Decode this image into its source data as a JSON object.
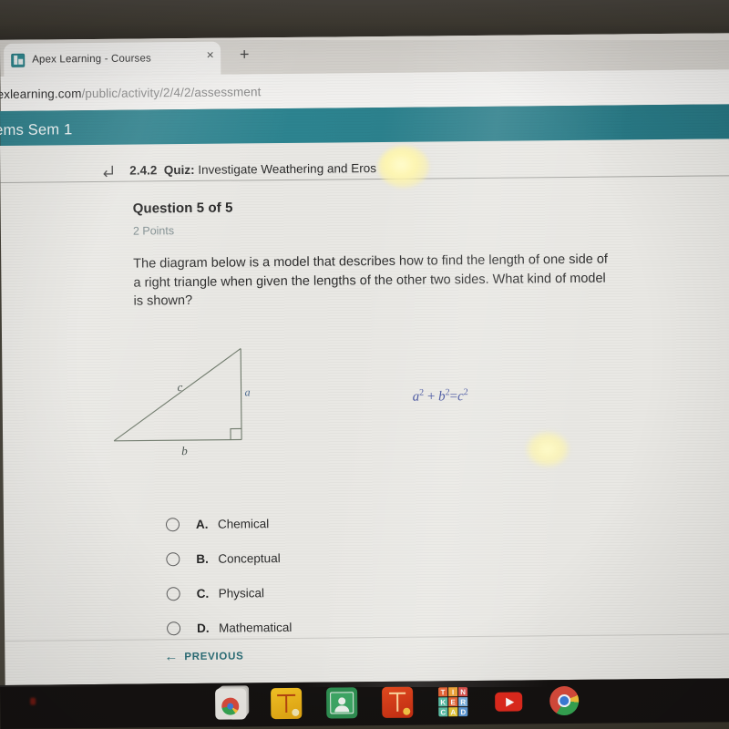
{
  "browser": {
    "tab": {
      "title": "Apex Learning - Courses",
      "favicon": "apex-favicon",
      "close_icon": "×"
    },
    "new_tab_icon": "+",
    "url_visible": "exlearning.com",
    "url_path": "/public/activity/2/4/2/assessment"
  },
  "app_header": {
    "course_title": "ems Sem 1"
  },
  "quiz_bar": {
    "back_icon": "back-arrow-icon",
    "number": "2.4.2",
    "type": "Quiz:",
    "name": "Investigate Weathering and Eros"
  },
  "question": {
    "counter": "Question 5 of 5",
    "points": "2 Points",
    "text": "The diagram below is a model that describes how to find the length of one side of a right triangle when given the lengths of the other two sides. What kind of model is shown?"
  },
  "diagram": {
    "label_hypotenuse": "c",
    "label_vertical": "a",
    "label_base": "b",
    "formula": {
      "a": "a",
      "a_exp": "2",
      "plus": "+",
      "b": "b",
      "b_exp": "2",
      "equals": "=",
      "c": "c",
      "c_exp": "2"
    },
    "right_angle_marker": "right-angle-icon",
    "stroke_color": "#6f7a6b",
    "formula_color": "#3d4c9b"
  },
  "choices": [
    {
      "letter": "A.",
      "label": "Chemical",
      "selected": false
    },
    {
      "letter": "B.",
      "label": "Conceptual",
      "selected": false
    },
    {
      "letter": "C.",
      "label": "Physical",
      "selected": false
    },
    {
      "letter": "D.",
      "label": "Mathematical",
      "selected": false
    }
  ],
  "footer": {
    "prev_arrow": "←",
    "prev_label": "PREVIOUS"
  },
  "taskbar": {
    "items": [
      {
        "name": "chrome-windows-icon",
        "label": "Chrome Windows"
      },
      {
        "name": "yellow-cad-icon",
        "label": "CAD App"
      },
      {
        "name": "google-classroom-icon",
        "label": "Google Classroom"
      },
      {
        "name": "red-burst-icon",
        "label": "Red App"
      },
      {
        "name": "tinkercad-icon",
        "label": "Tinkercad"
      },
      {
        "name": "youtube-icon",
        "label": "YouTube"
      },
      {
        "name": "chrome-icon",
        "label": "Google Chrome"
      }
    ],
    "tinkercad_letters": [
      "T",
      "I",
      "N",
      "K",
      "E",
      "R",
      "C",
      "A",
      "D"
    ],
    "tinkercad_colors": [
      "#e8683a",
      "#f0a63c",
      "#d9534f",
      "#5ec1a8",
      "#e8683a",
      "#7fb3e0",
      "#5ec1a8",
      "#e8c93c",
      "#5f9ad6"
    ]
  },
  "colors": {
    "teal_header": "#2d8490",
    "page_bg": "#e9e8e4",
    "accent_link": "#2b6d76"
  }
}
